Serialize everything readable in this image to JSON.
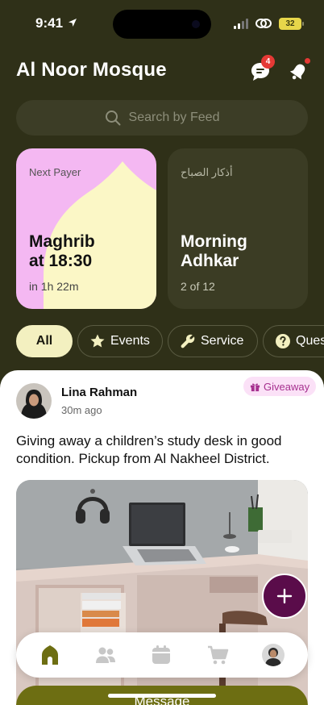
{
  "status_bar": {
    "time": "9:41",
    "battery": "32"
  },
  "header": {
    "title": "Al Noor Mosque",
    "chat_badge": "4",
    "icons": [
      "chat-icon",
      "bell-icon"
    ]
  },
  "search": {
    "placeholder": "Search by Feed"
  },
  "cards": [
    {
      "label": "Next Payer",
      "title_line1": "Maghrib",
      "title_line2": "at 18:30",
      "subtitle": "in 1h 22m"
    },
    {
      "label": "أذكار الصباح",
      "title_line1": "Morning",
      "title_line2": "Adhkar",
      "subtitle": "2 of 12"
    }
  ],
  "filters": [
    {
      "label": "All",
      "active": true
    },
    {
      "label": "Events",
      "icon": "star-icon"
    },
    {
      "label": "Service",
      "icon": "wrench-icon"
    },
    {
      "label": "Ques",
      "icon": "question-icon"
    }
  ],
  "post": {
    "author": "Lina Rahman",
    "time": "30m ago",
    "tag": "Giveaway",
    "text": "Giving away a children’s study desk in good condition. Pickup from Al Nakheel District."
  },
  "bottom_nav": {
    "items": [
      "home-icon",
      "people-icon",
      "calendar-icon",
      "cart-icon",
      "profile-avatar"
    ],
    "active": "home-icon"
  },
  "message_button": {
    "label": "Message"
  },
  "colors": {
    "background": "#2f3018",
    "accent": "#6d6e12",
    "fab": "#5a0c4a",
    "chip_active": "#f3f0c0",
    "prayer_card": "#f4b8f2",
    "tag_text": "#a6308f"
  }
}
